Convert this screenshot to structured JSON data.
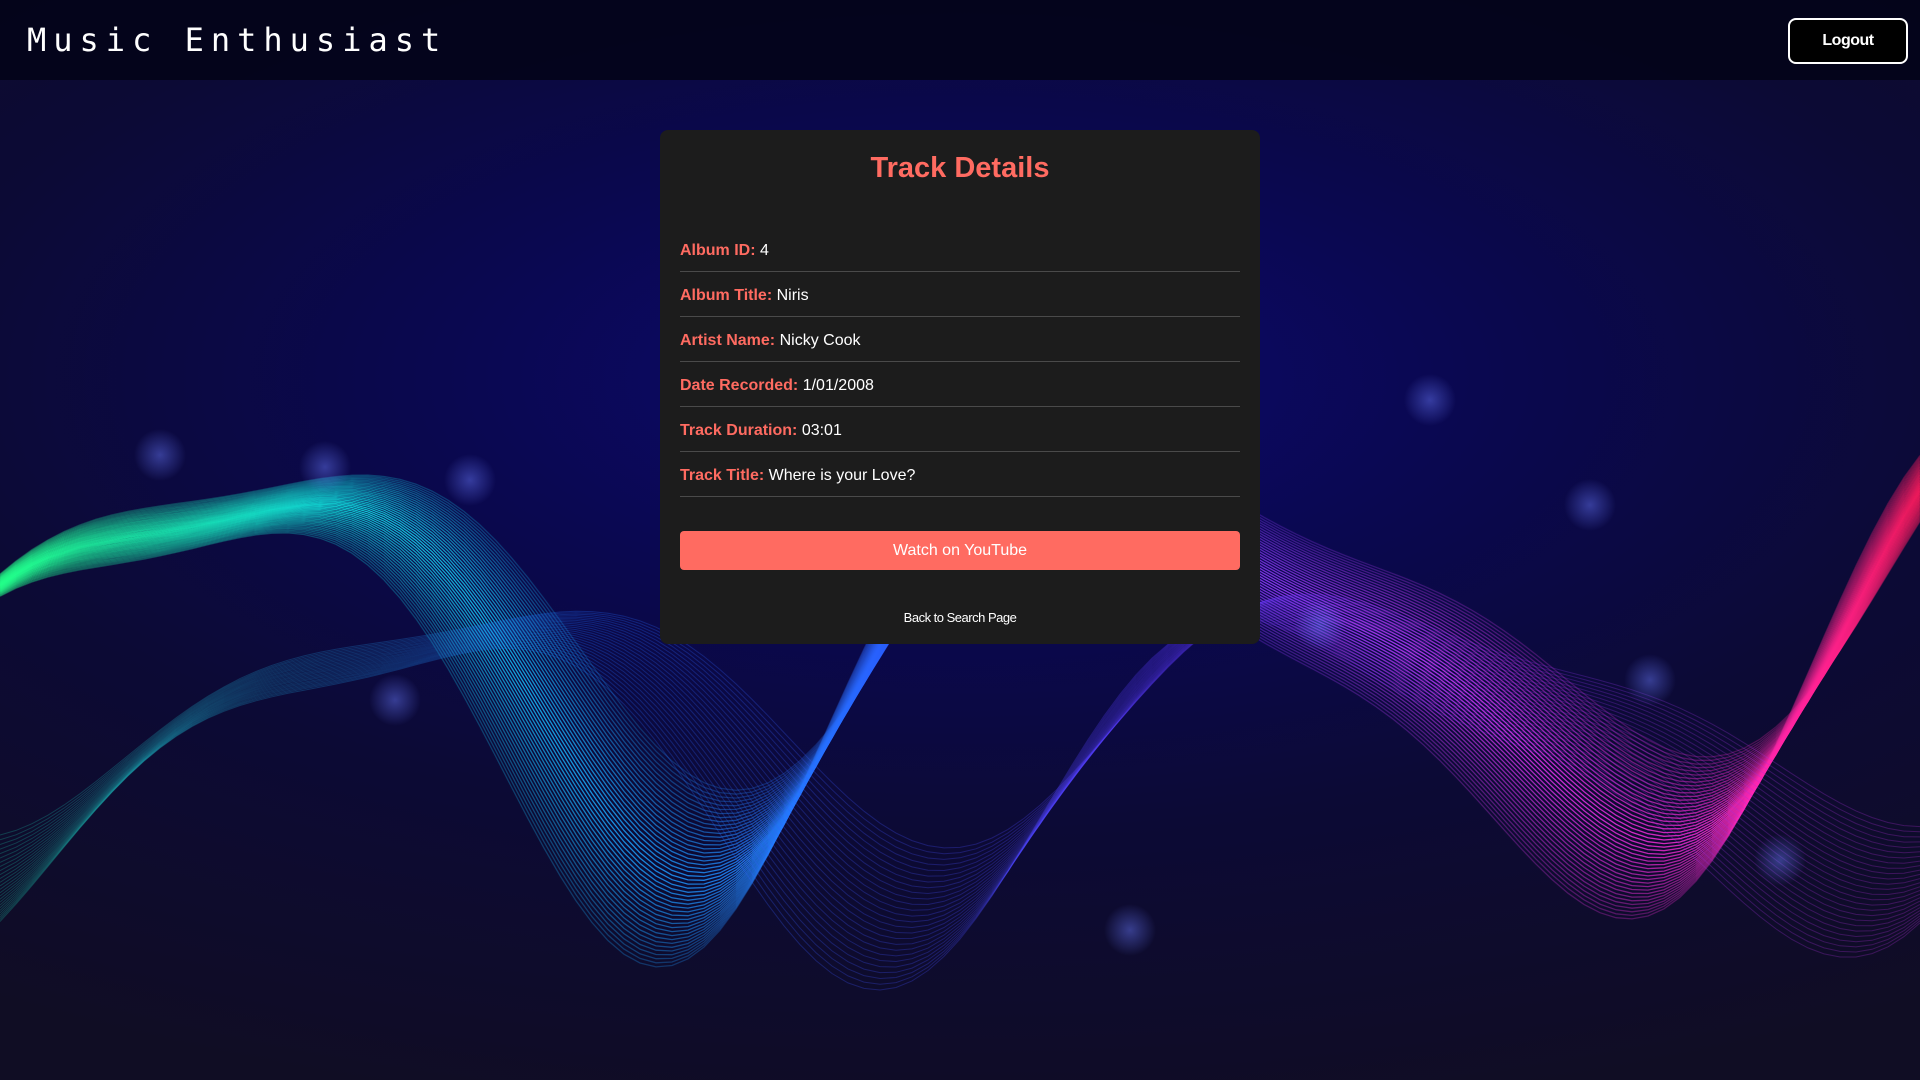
{
  "header": {
    "brand": "Music Enthusiast",
    "logout_label": "Logout"
  },
  "card": {
    "title": "Track Details",
    "rows": [
      {
        "label": "Album ID:",
        "value": "4"
      },
      {
        "label": "Album Title:",
        "value": "Niris"
      },
      {
        "label": "Artist Name:",
        "value": "Nicky Cook"
      },
      {
        "label": "Date Recorded:",
        "value": "1/01/2008"
      },
      {
        "label": "Track Duration:",
        "value": "03:01"
      },
      {
        "label": "Track Title:",
        "value": "Where is your Love?"
      }
    ],
    "youtube_button": "Watch on YouTube",
    "back_link": "Back to Search Page"
  },
  "colors": {
    "accent": "#ff6b61",
    "card_bg": "#1c1c1c",
    "header_bg": "#030318",
    "page_bg": "#0c0a35"
  },
  "icons": []
}
